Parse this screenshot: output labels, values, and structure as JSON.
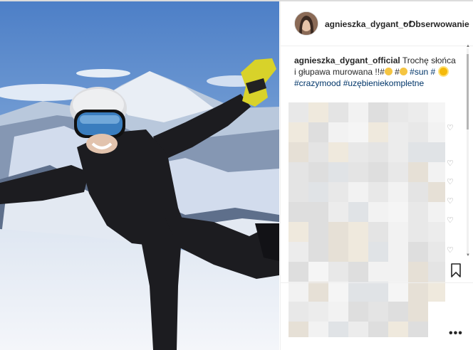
{
  "post": {
    "username": "agnieszka_dygant_of",
    "dot": "•",
    "follow_label": "Obserwowanie",
    "caption": {
      "username": "agnieszka_dygant_official",
      "text_line1": "Trochę słońca i",
      "text_line2": "głupawa murowana !!#",
      "hashtag_sun": "#sun",
      "hashtag_hash": "#",
      "hashtag_crazymood": "#crazymood",
      "hashtag_uzbienie": "#uzębieniekompletne"
    },
    "more_label": "•••"
  },
  "icons": {
    "avatar": "profile-avatar",
    "heart": "heart-icon",
    "bookmark": "bookmark-icon",
    "more": "more-options-icon"
  },
  "colors": {
    "link": "#003569",
    "text": "#262626",
    "sky": "#6a95cf"
  }
}
